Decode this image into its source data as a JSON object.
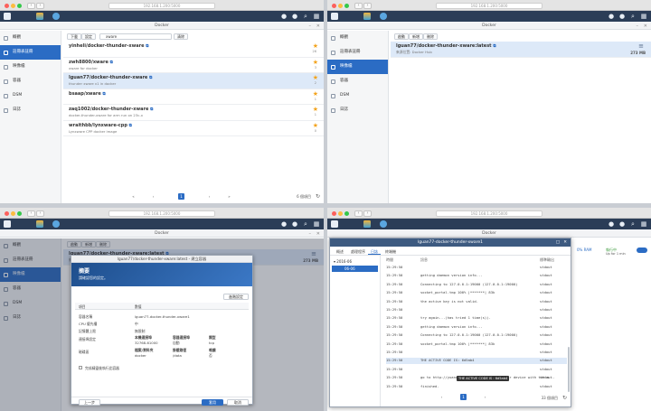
{
  "browser": {
    "url": "192.168.1.200:5000"
  },
  "app": {
    "title": "Docker",
    "nav_back": "‹",
    "nav_fwd": "›"
  },
  "sidebar": {
    "items": [
      {
        "label": "概觀"
      },
      {
        "label": "註冊表註冊"
      },
      {
        "label": "映像檔"
      },
      {
        "label": "容器"
      },
      {
        "label": "DSM"
      },
      {
        "label": "日誌"
      }
    ]
  },
  "registry": {
    "toolbar": {
      "download": "下載",
      "settings": "設定",
      "search_value": "xware",
      "search_clear": "✕",
      "clear_button": "清除"
    },
    "repos": [
      {
        "name": "yinheli/docker-thunder-xware",
        "desc": "",
        "stars": "26"
      },
      {
        "name": "zwh8800/xware",
        "desc": "xware for docker",
        "stars": "3"
      },
      {
        "name": "lguan77/docker-thunder-xware",
        "desc": "thunder xware v1 in docker",
        "stars": "2"
      },
      {
        "name": "bsaap/xware",
        "desc": "",
        "stars": "1"
      },
      {
        "name": "zaq1002/docker-thunder-xware",
        "desc": "docker-thunder-xware for arm run on 23c-x",
        "stars": "1"
      },
      {
        "name": "wraithbb/lynxware-cpp",
        "desc": "Lynxware CPP docker image",
        "stars": "0"
      }
    ],
    "pager": {
      "prev": "«",
      "prev1": "‹",
      "page": "1",
      "next1": "›",
      "next": "»",
      "count": "6 個項目"
    }
  },
  "images": {
    "toolbar": {
      "launch": "啟動",
      "add": "新增",
      "delete": "刪除"
    },
    "item": {
      "name": "lguan77/docker-thunder-xware:latest",
      "source": "來源位置: Docker Hub",
      "size": "273 MB"
    }
  },
  "wizard": {
    "title": "lguan77/docker-thunder-xware:latest - 建立容器",
    "banner_title": "摘要",
    "banner_sub": "請確認您的設定。",
    "edit_button": "進階設定",
    "header_item": "項目",
    "header_value": "數值",
    "rows": [
      {
        "k": "容器名稱",
        "v": "lguan77-docker-thunder-xware1"
      },
      {
        "k": "CPU 優先權",
        "v": "中"
      },
      {
        "k": "記憶體上限",
        "v": "無限制"
      },
      {
        "k": "連接埠設定",
        "v": ""
      },
      {
        "k": "磁碟區",
        "v": ""
      }
    ],
    "port_headers": [
      "本機連接埠",
      "容器連接埠",
      "類型"
    ],
    "port_row": [
      "32768-61000",
      "自動",
      "tcp"
    ],
    "vol_headers": [
      "檔案/資料夾",
      "掛載路徑",
      "唯讀"
    ],
    "vol_row": [
      "docker",
      "/data",
      "否"
    ],
    "checkbox": "完成精靈後執行此容器",
    "back": "上一步",
    "apply": "套用",
    "cancel": "取消"
  },
  "log": {
    "title": "lguan77-docker-thunder-xware1",
    "tabs": [
      "概述",
      "處理程序",
      "日誌",
      "終端機"
    ],
    "date_group": "2016-06",
    "date_item": "06-06",
    "col_time": "時間",
    "col_msg": "訊息",
    "col_stream": "標準輸出",
    "lines": [
      {
        "t": "15:29:50",
        "m": "",
        "s": "stdout"
      },
      {
        "t": "15:29:50",
        "m": "getting daemon version info...",
        "s": "stdout"
      },
      {
        "t": "15:29:50",
        "m": "Connecting to 127.0.0.1:19000 (127.0.0.1:19000)",
        "s": "stdout"
      },
      {
        "t": "15:29:50",
        "m": "socket_portal.tmp    100% |*******| 83k",
        "s": "stdout"
      },
      {
        "t": "15:29:50",
        "m": "the active key is not valid.",
        "s": "stdout"
      },
      {
        "t": "15:29:50",
        "m": "",
        "s": "stdout"
      },
      {
        "t": "15:29:50",
        "m": "try again...(has tried 1 time(s)).",
        "s": "stdout"
      },
      {
        "t": "15:29:50",
        "m": "getting daemon version info...",
        "s": "stdout"
      },
      {
        "t": "15:29:50",
        "m": "Connecting to 127.0.0.1:19000 (127.0.0.1:19000)",
        "s": "stdout"
      },
      {
        "t": "15:29:50",
        "m": "socket_portal.tmp    100% |*******| 83k",
        "s": "stdout"
      },
      {
        "t": "15:29:50",
        "m": "",
        "s": "stdout"
      },
      {
        "t": "15:29:50",
        "m": "THE ACTIVE CODE IS: 6d5ab4",
        "s": "stdout"
      },
      {
        "t": "15:29:50",
        "m": "",
        "s": "stdout"
      },
      {
        "t": "15:29:50",
        "m": "go to http://yuancheng.xunlei.com, bind your device with the a...",
        "s": "stdout"
      },
      {
        "t": "15:29:50",
        "m": "finished.",
        "s": "stdout"
      }
    ],
    "tooltip": "THE ACTIVE CODE IS : 6d5ab4",
    "page": "1",
    "count": "33 個項目",
    "side_status": "執行中",
    "side_time": "Up for 1 min",
    "side_cpu": "0% RAM"
  }
}
